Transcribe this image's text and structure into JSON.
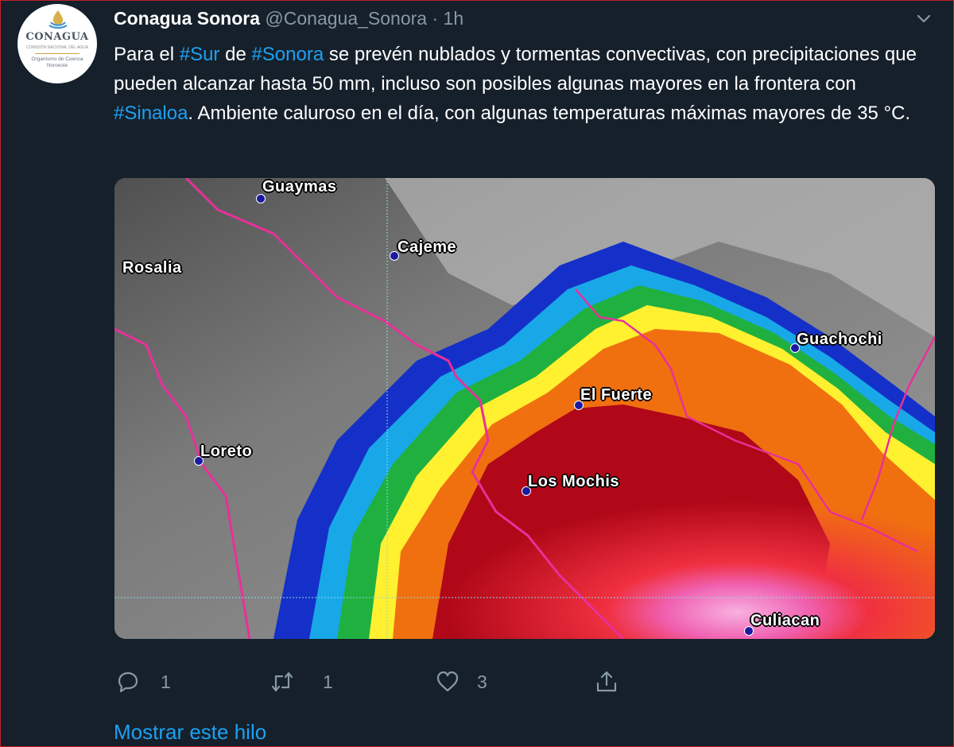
{
  "account": {
    "display_name": "Conagua Sonora",
    "handle": "@Conagua_Sonora",
    "separator": "·",
    "time": "1h",
    "avatar": {
      "logo_text": "CONAGUA",
      "subtitle": "COMISIÓN NACIONAL DEL AGUA",
      "region_line1": "Organismo de Cuenca",
      "region_line2": "Noroeste"
    }
  },
  "tweet": {
    "text_parts": [
      {
        "text": "Para el ",
        "hashtag": false
      },
      {
        "text": "#Sur",
        "hashtag": true
      },
      {
        "text": " de ",
        "hashtag": false
      },
      {
        "text": "#Sonora",
        "hashtag": true
      },
      {
        "text": " se prevén nublados y tormentas convectivas, con precipitaciones que pueden alcanzar hasta 50 mm, incluso son posibles algunas mayores en la frontera con ",
        "hashtag": false
      },
      {
        "text": "#Sinaloa",
        "hashtag": true
      },
      {
        "text": ". Ambiente caluroso en el día, con algunas temperaturas máximas mayores de 35 °C.",
        "hashtag": false
      }
    ]
  },
  "map": {
    "cities": {
      "guaymas": "Guaymas",
      "cajeme": "Cajeme",
      "rosalia": "Rosalia",
      "guachochi": "Guachochi",
      "el_fuerte": "El Fuerte",
      "loreto": "Loreto",
      "los_mochis": "Los Mochis",
      "culiacan": "Culiacan"
    },
    "colors": {
      "cloud_gray": "#8a8a8a",
      "blue": "#1530c8",
      "cyan": "#18a8e8",
      "green": "#20b040",
      "yellow": "#fff030",
      "orange": "#f07010",
      "dark_red": "#b00818",
      "red": "#f03040",
      "pink": "#f088c8",
      "border_magenta": "#e8309a"
    }
  },
  "actions": {
    "reply": {
      "icon": "reply-icon",
      "count": "1"
    },
    "retweet": {
      "icon": "retweet-icon",
      "count": "1"
    },
    "like": {
      "icon": "heart-icon",
      "count": "3"
    },
    "share": {
      "icon": "share-icon"
    }
  },
  "show_thread": "Mostrar este hilo"
}
